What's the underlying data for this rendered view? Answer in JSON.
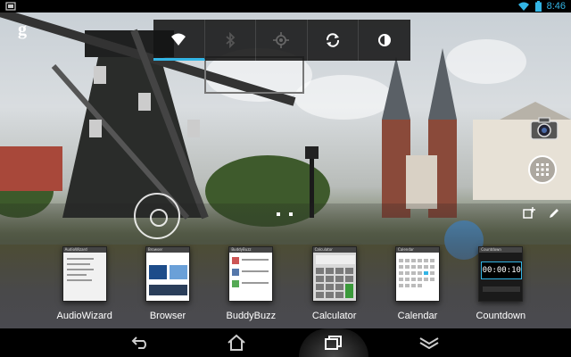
{
  "status_bar": {
    "time": "8:46",
    "icons": [
      "notification-icon",
      "wifi-icon",
      "battery-icon"
    ]
  },
  "home": {
    "google_search_glyph": "g",
    "quick_settings": [
      {
        "name": "wifi-icon",
        "active": true
      },
      {
        "name": "bluetooth-icon",
        "active": false
      },
      {
        "name": "gps-icon",
        "active": false
      },
      {
        "name": "sync-icon",
        "active": false
      },
      {
        "name": "brightness-icon",
        "active": false
      }
    ],
    "side_icons": [
      "camera-icon",
      "all-apps-icon"
    ]
  },
  "recents": {
    "tools": [
      "add-widget-icon",
      "edit-icon"
    ],
    "apps": [
      {
        "label": "AudioWizard"
      },
      {
        "label": "Browser"
      },
      {
        "label": "BuddyBuzz"
      },
      {
        "label": "Calculator"
      },
      {
        "label": "Calendar"
      },
      {
        "label": "Countdown",
        "timer": "00:00:10"
      }
    ]
  },
  "nav_bar": {
    "buttons": [
      "back-icon",
      "home-icon",
      "recent-apps-icon",
      "menu-icon"
    ]
  },
  "colors": {
    "accent": "#33b5e5",
    "status_bar": "#000000",
    "nav_bar": "#000000"
  }
}
